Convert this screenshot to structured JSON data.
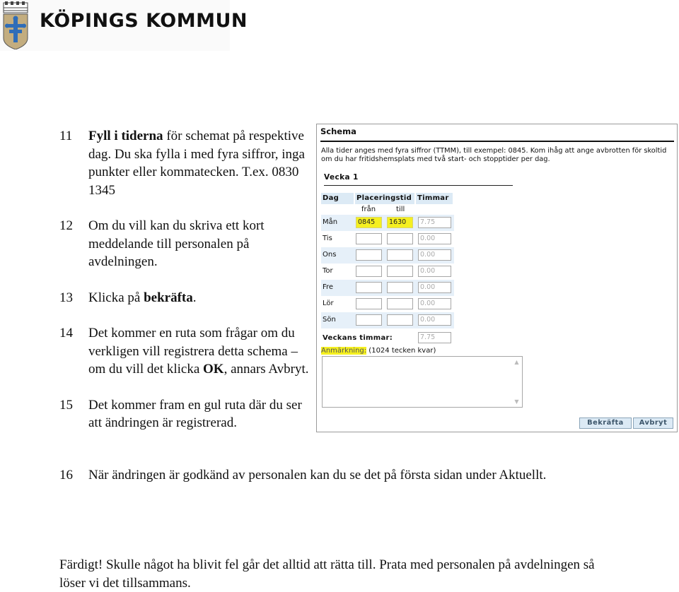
{
  "logo": {
    "text": "KÖPINGS KOMMUN",
    "crest_icon": "coat-of-arms-icon"
  },
  "steps": [
    {
      "num": "11",
      "bold": "Fyll i tiderna",
      "text": " för schemat på respektive dag. Du ska fylla i med fyra siffror, inga punkter eller kommatecken. T.ex. 0830 1345"
    },
    {
      "num": "12",
      "text": "Om du vill kan du skriva ett kort meddelande till personalen på avdelningen."
    },
    {
      "num": "13",
      "pre": "Klicka på ",
      "bold": "bekräfta",
      "post": "."
    },
    {
      "num": "14",
      "pre": "Det kommer en ruta som frågar om du verkligen vill registrera detta schema – om du vill det klicka ",
      "bold": "OK",
      "post": ", annars Avbryt."
    },
    {
      "num": "15",
      "text": "Det kommer fram en gul ruta där du ser att ändringen är registrerad."
    },
    {
      "num": "16",
      "text": "När ändringen är godkänd av personalen kan du se det på första sidan under Aktuellt."
    }
  ],
  "closing": "Färdigt! Skulle något ha blivit fel går det alltid att rätta till. Prata med personalen på avdelningen så löser vi det tillsammans.",
  "schema": {
    "title": "Schema",
    "info": "Alla tider anges med fyra siffror (TTMM), till exempel: 0845. Kom ihåg att ange avbrotten för skoltid om du har fritidshemsplats med två start- och stopptider per dag.",
    "week": "Vecka 1",
    "headers": {
      "day": "Dag",
      "placement": "Placeringstid",
      "hours": "Timmar",
      "from": "från",
      "to": "till"
    },
    "rows": [
      {
        "day": "Mån",
        "from": "0845",
        "to": "1630",
        "hours": "7.75"
      },
      {
        "day": "Tis",
        "from": "",
        "to": "",
        "hours": "0.00"
      },
      {
        "day": "Ons",
        "from": "",
        "to": "",
        "hours": "0.00"
      },
      {
        "day": "Tor",
        "from": "",
        "to": "",
        "hours": "0.00"
      },
      {
        "day": "Fre",
        "from": "",
        "to": "",
        "hours": "0.00"
      },
      {
        "day": "Lör",
        "from": "",
        "to": "",
        "hours": "0.00"
      },
      {
        "day": "Sön",
        "from": "",
        "to": "",
        "hours": "0.00"
      }
    ],
    "total_label": "Veckans timmar:",
    "total_value": "7.75",
    "note_label": "Anmärkning:",
    "note_counter": " (1024 tecken kvar)",
    "note_value": "",
    "confirm_label": "Bekräfta",
    "cancel_label": "Avbryt",
    "highlight_color": "#f5f020",
    "header_color": "#dceaf5"
  }
}
